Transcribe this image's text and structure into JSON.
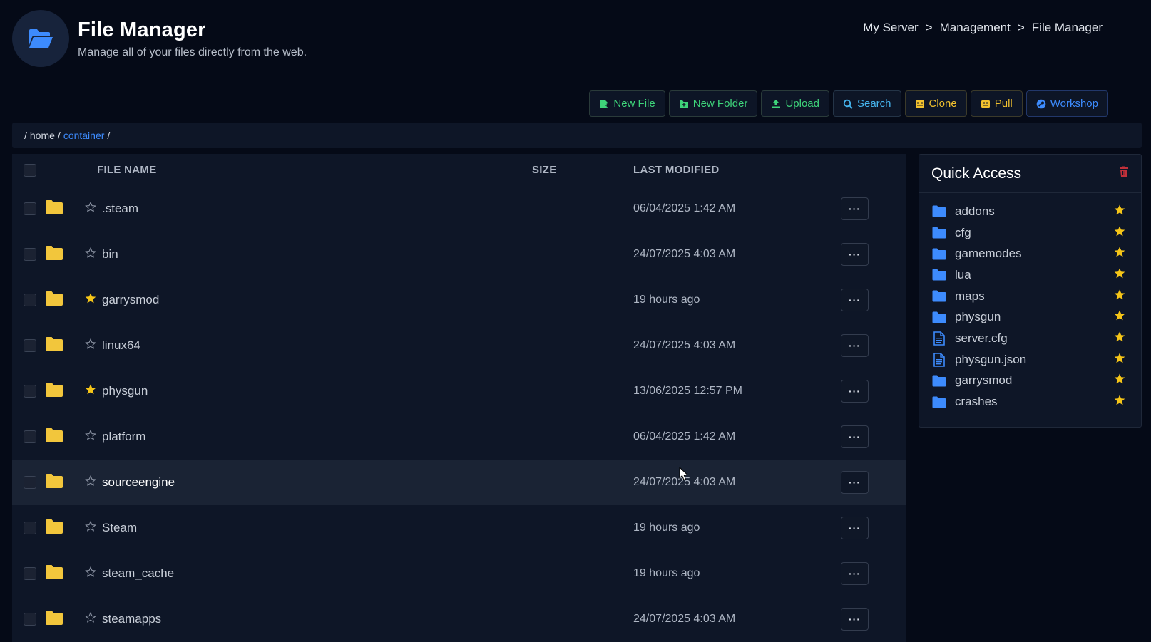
{
  "header": {
    "title": "File Manager",
    "subtitle": "Manage all of your files directly from the web.",
    "logo_icon": "folder-open-icon"
  },
  "breadcrumb": {
    "items": [
      "My Server",
      "Management",
      "File Manager"
    ],
    "separator": ">"
  },
  "toolbar": {
    "buttons": [
      {
        "label": "New File",
        "icon": "file-plus-icon",
        "color": "#3ed37a"
      },
      {
        "label": "New Folder",
        "icon": "folder-plus-icon",
        "color": "#3ed37a"
      },
      {
        "label": "Upload",
        "icon": "upload-icon",
        "color": "#3ed37a"
      },
      {
        "label": "Search",
        "icon": "search-icon",
        "color": "#47b6f0"
      },
      {
        "label": "Clone",
        "icon": "git-icon",
        "color": "#f2c12e"
      },
      {
        "label": "Pull",
        "icon": "git-icon",
        "color": "#f2c12e"
      },
      {
        "label": "Workshop",
        "icon": "steam-icon",
        "color": "#3d8bfd"
      }
    ]
  },
  "path": {
    "root": "/",
    "segments": [
      "home",
      "container"
    ],
    "separator": "/"
  },
  "table": {
    "columns": {
      "name": "FILE NAME",
      "size": "SIZE",
      "modified": "LAST MODIFIED"
    },
    "more_label": "···",
    "rows": [
      {
        "name": ".steam",
        "size": "",
        "modified": "06/04/2025 1:42 AM",
        "starred": false
      },
      {
        "name": "bin",
        "size": "",
        "modified": "24/07/2025 4:03 AM",
        "starred": false
      },
      {
        "name": "garrysmod",
        "size": "",
        "modified": "19 hours ago",
        "starred": true
      },
      {
        "name": "linux64",
        "size": "",
        "modified": "24/07/2025 4:03 AM",
        "starred": false
      },
      {
        "name": "physgun",
        "size": "",
        "modified": "13/06/2025 12:57 PM",
        "starred": true
      },
      {
        "name": "platform",
        "size": "",
        "modified": "06/04/2025 1:42 AM",
        "starred": false
      },
      {
        "name": "sourceengine",
        "size": "",
        "modified": "24/07/2025 4:03 AM",
        "starred": false,
        "hover": true
      },
      {
        "name": "Steam",
        "size": "",
        "modified": "19 hours ago",
        "starred": false
      },
      {
        "name": "steam_cache",
        "size": "",
        "modified": "19 hours ago",
        "starred": false
      },
      {
        "name": "steamapps",
        "size": "",
        "modified": "24/07/2025 4:03 AM",
        "starred": false
      }
    ]
  },
  "quick_access": {
    "title": "Quick Access",
    "items": [
      {
        "label": "addons",
        "type": "folder"
      },
      {
        "label": "cfg",
        "type": "folder"
      },
      {
        "label": "gamemodes",
        "type": "folder"
      },
      {
        "label": "lua",
        "type": "folder"
      },
      {
        "label": "maps",
        "type": "folder"
      },
      {
        "label": "physgun",
        "type": "folder"
      },
      {
        "label": "server.cfg",
        "type": "file"
      },
      {
        "label": "physgun.json",
        "type": "file"
      },
      {
        "label": "garrysmod",
        "type": "folder"
      },
      {
        "label": "crashes",
        "type": "folder"
      }
    ]
  },
  "colors": {
    "folder": "#f2c63c",
    "star_active": "#f5c518",
    "qa_folder": "#3d8bfd",
    "trash": "#c0303a"
  }
}
